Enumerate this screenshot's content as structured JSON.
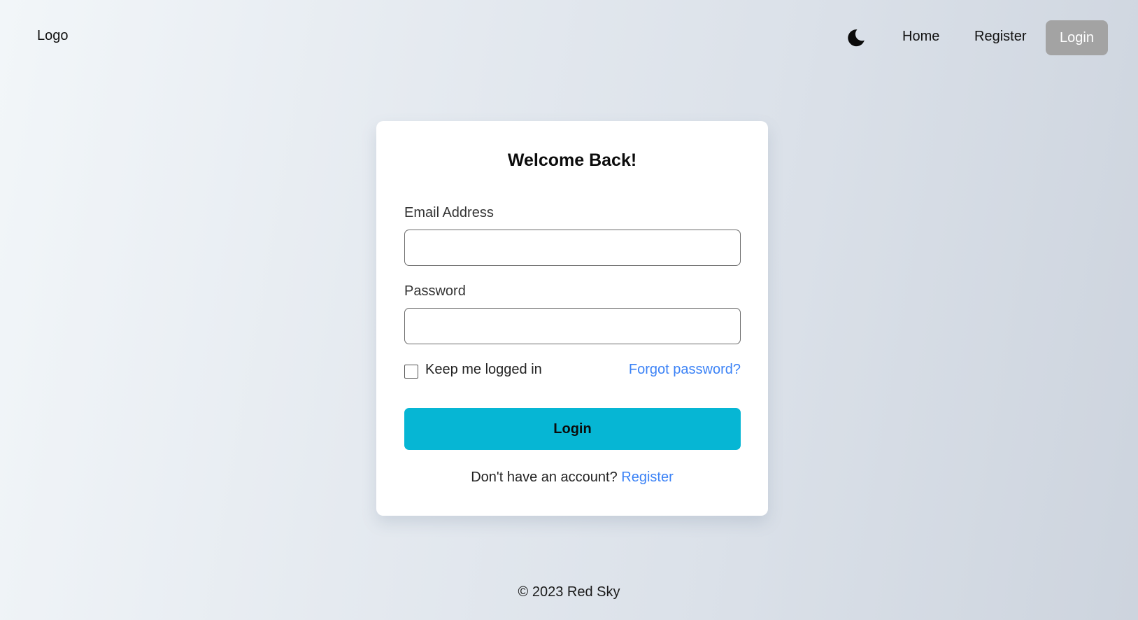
{
  "header": {
    "logo": "Logo",
    "theme_icon": "moon-icon",
    "nav": {
      "home": "Home",
      "register": "Register",
      "login": "Login"
    },
    "colors": {
      "active_nav_bg": "#a3a3a3"
    }
  },
  "login_card": {
    "title": "Welcome Back!",
    "email_label": "Email Address",
    "email_value": "",
    "password_label": "Password",
    "password_value": "",
    "remember_label": "Keep me logged in",
    "remember_checked": false,
    "forgot_link": "Forgot password?",
    "submit_label": "Login",
    "signup_prompt": "Don't have an account?",
    "signup_link": "Register",
    "colors": {
      "button": "#06b6d4",
      "link": "#3b82f6"
    }
  },
  "footer": {
    "copyright": "© 2023 Red Sky"
  }
}
